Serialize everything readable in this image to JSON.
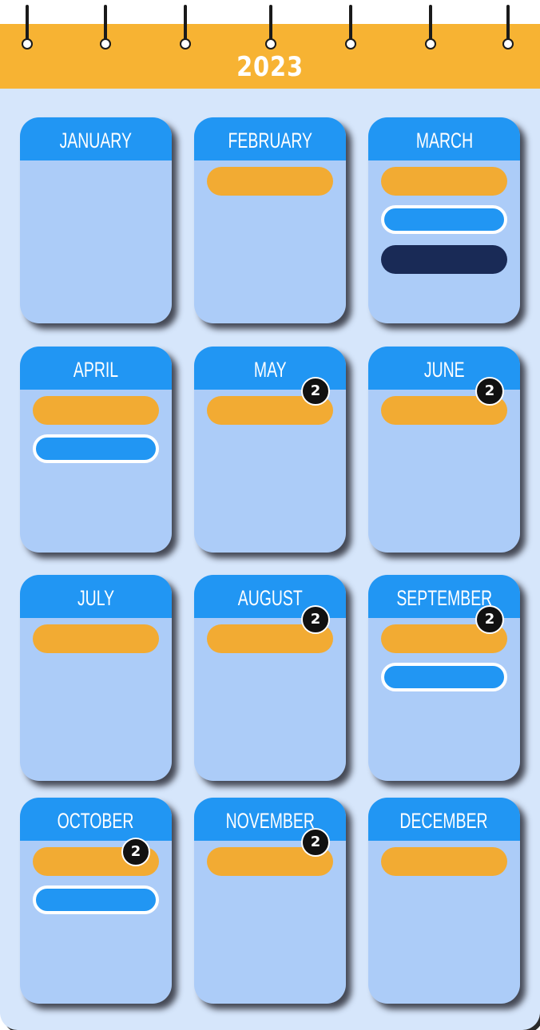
{
  "calendar": {
    "year": "2023",
    "colors": {
      "header": "#f7b333",
      "board": "#d6e6fb",
      "card": "#acccf8",
      "month_header": "#2196f3",
      "event_orange": "#f2ab33",
      "event_blue": "#2196f3",
      "event_navy": "#192a56",
      "badge": "#111111"
    },
    "months": [
      {
        "name": "JANUARY",
        "events": []
      },
      {
        "name": "FEBRUARY",
        "events": [
          "orange"
        ]
      },
      {
        "name": "MARCH",
        "events": [
          "orange",
          "blue",
          "navy"
        ]
      },
      {
        "name": "APRIL",
        "events": [
          "orange",
          "blue"
        ]
      },
      {
        "name": "MAY",
        "events": [
          "orange"
        ],
        "badge": "2"
      },
      {
        "name": "JUNE",
        "events": [
          "orange"
        ],
        "badge": "2"
      },
      {
        "name": "JULY",
        "events": [
          "orange"
        ]
      },
      {
        "name": "AUGUST",
        "events": [
          "orange"
        ],
        "badge": "2"
      },
      {
        "name": "SEPTEMBER",
        "events": [
          "orange",
          "blue"
        ],
        "badge": "2"
      },
      {
        "name": "OCTOBER",
        "events": [
          "orange",
          "blue"
        ],
        "badge": "2"
      },
      {
        "name": "NOVEMBER",
        "events": [
          "orange"
        ],
        "badge": "2"
      },
      {
        "name": "DECEMBER",
        "events": [
          "orange"
        ]
      }
    ]
  }
}
